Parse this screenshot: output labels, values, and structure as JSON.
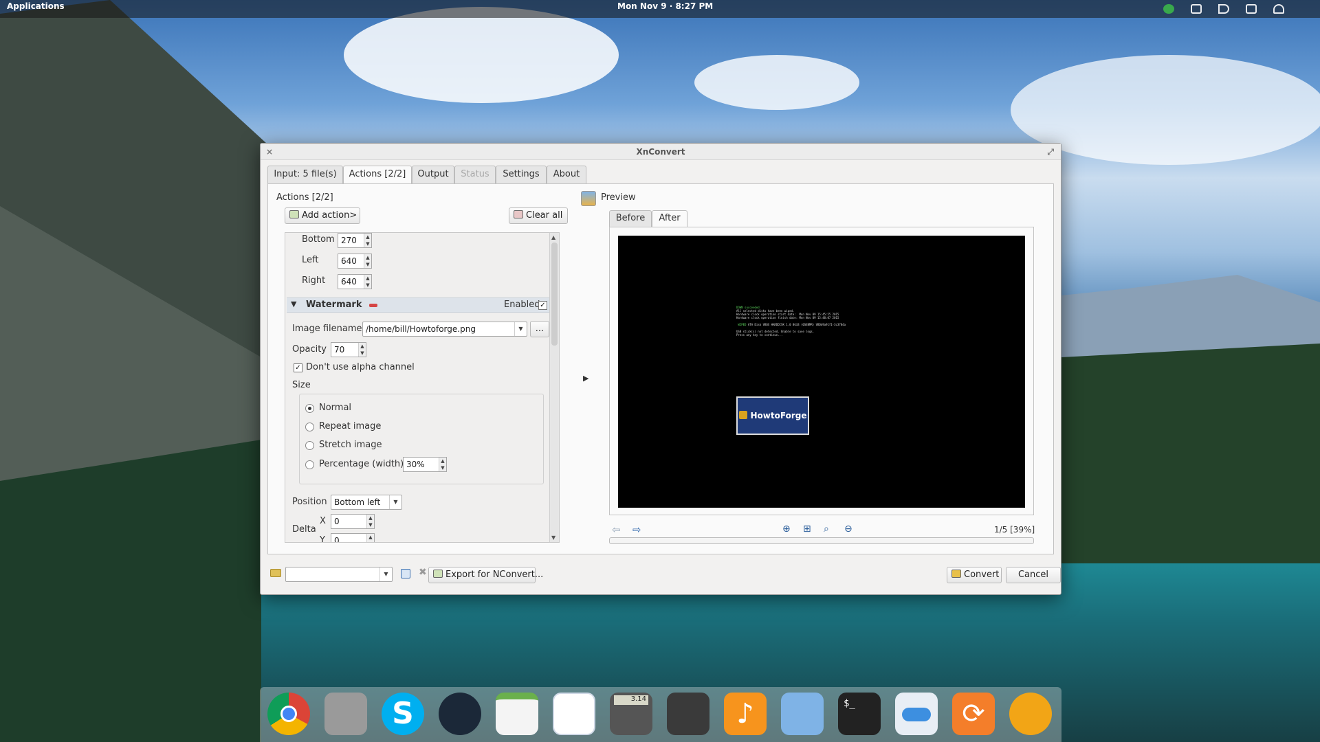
{
  "desktop": {
    "topbar": {
      "applications": "Applications",
      "clock": "Mon Nov 9 · 8:27 PM"
    }
  },
  "window": {
    "title": "XnConvert",
    "tabs": [
      {
        "label": "Input: 5 file(s)"
      },
      {
        "label": "Actions [2/2]"
      },
      {
        "label": "Output"
      },
      {
        "label": "Status"
      },
      {
        "label": "Settings"
      },
      {
        "label": "About"
      }
    ],
    "actions": {
      "heading": "Actions [2/2]",
      "add_action": "Add action>",
      "clear_all": "Clear all",
      "crop": {
        "bottom_label": "Bottom",
        "bottom_value": "270",
        "left_label": "Left",
        "left_value": "640",
        "right_label": "Right",
        "right_value": "640"
      },
      "watermark": {
        "title": "Watermark",
        "enabled_label": "Enabled",
        "enabled_check": "✓",
        "image_filename_label": "Image filename",
        "image_filename_value": "/home/bill/Howtoforge.png",
        "browse": "...",
        "opacity_label": "Opacity",
        "opacity_value": "70",
        "alpha_label": "Don't use alpha channel",
        "alpha_check": "✓",
        "size_label": "Size",
        "size_options": [
          {
            "label": "Normal",
            "selected": true
          },
          {
            "label": "Repeat image",
            "selected": false
          },
          {
            "label": "Stretch image",
            "selected": false
          },
          {
            "label": "Percentage (width)",
            "selected": false
          }
        ],
        "percentage_value": "30%",
        "position_label": "Position",
        "position_value": "Bottom left",
        "delta_label": "Delta",
        "x_label": "X",
        "x_value": "0",
        "y_label": "Y",
        "y_value": "0"
      }
    },
    "preview": {
      "heading": "Preview",
      "tabs": [
        {
          "label": "Before"
        },
        {
          "label": "After"
        }
      ],
      "image_logo_text": "HowtoForge",
      "terminal": {
        "line1": "DOWN succeeded",
        "line2": "All selected disks have been wiped.",
        "line3": "Hardware clock operation start date:  Mon Nov 09 15:45:55 2015",
        "line4": "Hardware clock operation finish date: Mon Nov 09 15:48:07 2015",
        "line5_tag": "WIPED",
        "line5": "ATA Disk VBOX HARDDISK 1.0 8GiB (0SENMR) VBDd9a91f1-3c3784a",
        "line6": "USB stick(s) not detected. Unable to save logs.",
        "line7": "Press any key to continue..."
      },
      "page_info": "1/5 [39%]"
    },
    "bottom": {
      "export": "Export for NConvert...",
      "convert": "Convert",
      "cancel": "Cancel"
    }
  },
  "dock": {
    "icons": [
      "chrome-icon",
      "files-icon",
      "skype-icon",
      "steam-icon",
      "calendar-icon",
      "image-viewer-icon",
      "calculator-icon",
      "screenshot-icon",
      "music-icon",
      "photos-icon",
      "terminal-icon",
      "settings-toggle-icon",
      "update-icon",
      "xnconvert-icon"
    ],
    "calculator_display": "3.14",
    "terminal_prompt": "$_"
  },
  "colors": {
    "accent": "#1f3a78",
    "section": "#dde3ea"
  }
}
